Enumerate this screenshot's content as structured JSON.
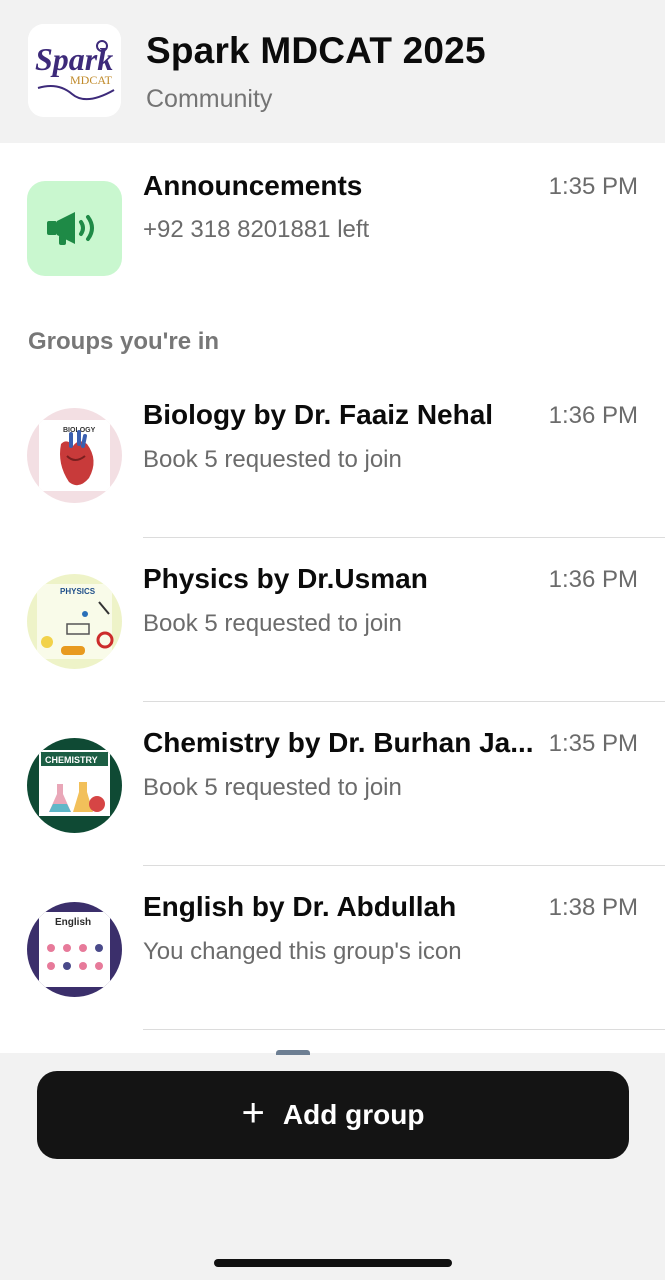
{
  "community": {
    "name": "Spark MDCAT 2025",
    "subtitle": "Community",
    "logo": {
      "word": "Spark",
      "tag": "MDCAT"
    }
  },
  "announcements": {
    "title": "Announcements",
    "subtitle": "+92 318 8201881 left",
    "time": "1:35 PM",
    "icon": "megaphone-icon"
  },
  "groups_label": "Groups you're in",
  "groups": [
    {
      "title": "Biology by Dr. Faaiz Nehal",
      "subtitle": "Book 5 requested to join",
      "time": "1:36 PM",
      "icon_text": "BIOLOGY"
    },
    {
      "title": "Physics by Dr.Usman",
      "subtitle": "Book 5 requested to join",
      "time": "1:36 PM",
      "icon_text": "PHYSICS"
    },
    {
      "title": "Chemistry by Dr. Burhan Ja...",
      "subtitle": "Book 5 requested to join",
      "time": "1:35 PM",
      "icon_text": "CHEMISTRY"
    },
    {
      "title": "English by Dr. Abdullah",
      "subtitle": "You changed this group's icon",
      "time": "1:38 PM",
      "icon_text": "English"
    }
  ],
  "add_group": {
    "label": "Add group",
    "icon": "plus-icon"
  },
  "colors": {
    "header_bg": "#f2f2f2",
    "announce_bg": "#c9f7cf",
    "announce_icon": "#1e8a46",
    "button_bg": "#141414"
  }
}
